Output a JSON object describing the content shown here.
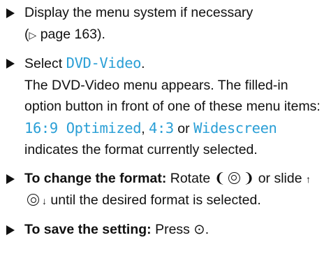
{
  "steps": [
    {
      "line1": "Display the menu system if necessary",
      "line2_open": "(",
      "line2_arrow": "▷",
      "line2_text": " page 163)."
    },
    {
      "select_prefix": "Select ",
      "select_item": "DVD-Video",
      "select_suffix": ".",
      "desc_a": "The DVD-Video menu appears. The filled-in option button in front of one of these menu items: ",
      "opt1": "16:9 Optimized",
      "sep1": ", ",
      "opt2": "4:3",
      "sep2": " or ",
      "opt3": "Widescreen",
      "desc_b": " indicates the format currently selected."
    },
    {
      "bold": "To change the format:",
      "rotate": " Rotate ",
      "rot_left": "❨",
      "rot_right": "❩",
      "or_slide": " or slide ",
      "up": "↑",
      "down": "↓",
      "tail": " until the desired format is selected."
    },
    {
      "bold": "To save the setting:",
      "press": " Press ",
      "press_icon": "⊙",
      "end": "."
    }
  ]
}
